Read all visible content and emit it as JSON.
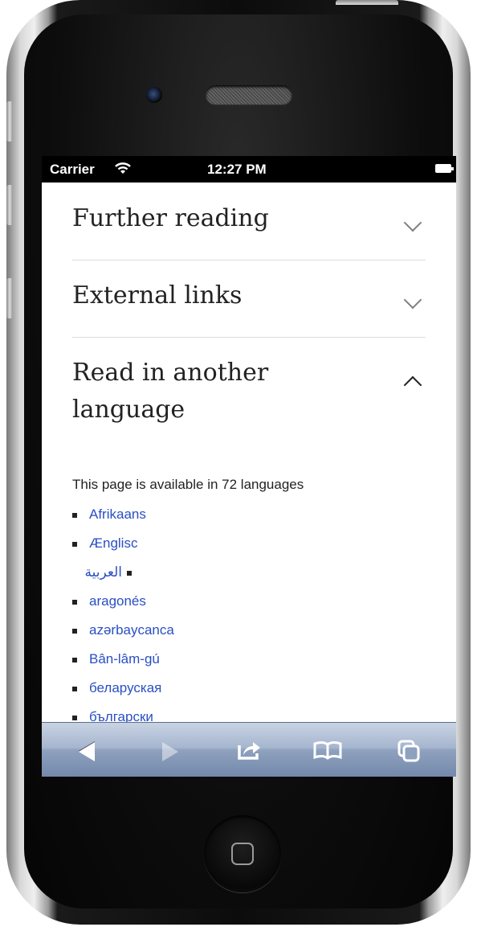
{
  "status_bar": {
    "carrier": "Carrier",
    "time": "12:27 PM"
  },
  "sections": [
    {
      "title": "Further reading",
      "expanded": false
    },
    {
      "title": "External links",
      "expanded": false
    },
    {
      "title": "Read in another language",
      "expanded": true
    }
  ],
  "languages": {
    "availability_text": "This page is available in 72 languages",
    "items": [
      "Afrikaans",
      "Ænglisc",
      "العربية",
      "aragonés",
      "azərbaycanca",
      "Bân-lâm-gú",
      "беларуская",
      "български"
    ]
  },
  "toolbar": {
    "icons": [
      "back-icon",
      "forward-icon",
      "share-icon",
      "bookmarks-icon",
      "tabs-icon"
    ]
  },
  "colors": {
    "link": "#2a4fc3",
    "toolbar_top": "#c9d3e3",
    "toolbar_bottom": "#7488ab"
  }
}
